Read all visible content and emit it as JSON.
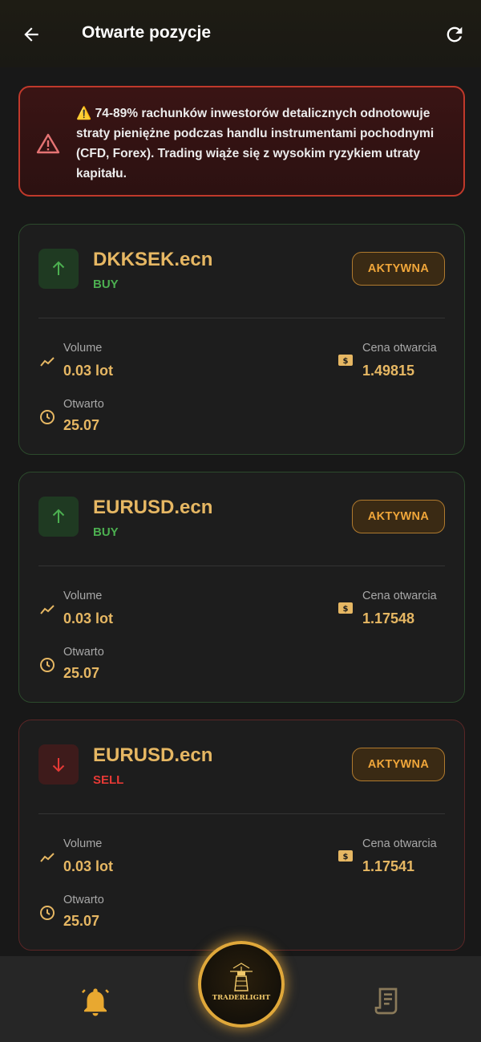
{
  "header": {
    "title": "Otwarte pozycje",
    "back_icon": "arrow-left-icon",
    "refresh_icon": "refresh-icon"
  },
  "warning": {
    "icon": "warning-triangle-icon",
    "text": "⚠️ 74-89% rachunków inwestorów detalicznych odnotowuje straty pieniężne podczas handlu instrumentami pochodnymi (CFD, Forex). Trading wiąże się z wysokim ryzykiem utraty kapitału."
  },
  "positions": [
    {
      "symbol": "DKKSEK.ecn",
      "side": "BUY",
      "status": "AKTYWNA",
      "volume_label": "Volume",
      "volume": "0.03 lot",
      "opened_label": "Otwarto",
      "opened": "25.07",
      "price_label": "Cena otwarcia",
      "price": "1.49815"
    },
    {
      "symbol": "EURUSD.ecn",
      "side": "BUY",
      "status": "AKTYWNA",
      "volume_label": "Volume",
      "volume": "0.03 lot",
      "opened_label": "Otwarto",
      "opened": "25.07",
      "price_label": "Cena otwarcia",
      "price": "1.17548"
    },
    {
      "symbol": "EURUSD.ecn",
      "side": "SELL",
      "status": "AKTYWNA",
      "volume_label": "Volume",
      "volume": "0.03 lot",
      "opened_label": "Otwarto",
      "opened": "25.07",
      "price_label": "Cena otwarcia",
      "price": "1.17541"
    }
  ],
  "bottom_nav": {
    "left_icon": "bell-icon",
    "center_logo_text": "TRADERLIGHT",
    "right_icon": "notes-icon"
  },
  "colors": {
    "accent": "#e6b763",
    "buy": "#4caf50",
    "sell": "#e53935",
    "status": "#f0a63a",
    "warning_border": "#c0392b"
  }
}
